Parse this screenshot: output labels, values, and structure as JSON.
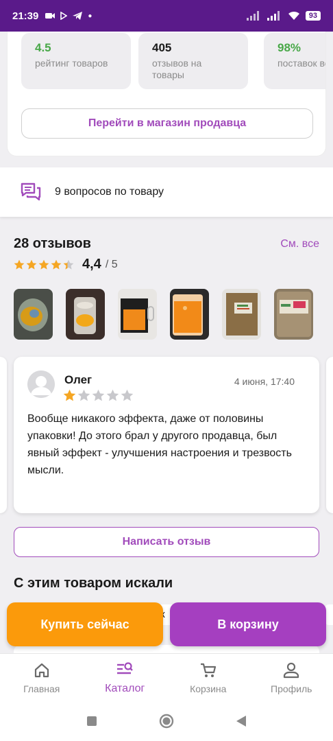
{
  "status_bar": {
    "time": "21:39",
    "battery": "93"
  },
  "seller": {
    "stats": [
      {
        "value": "4.5",
        "label": "рейтинг товаров"
      },
      {
        "value": "405",
        "label": "отзывов на товары"
      },
      {
        "value": "98%",
        "label": "поставок вовремя"
      }
    ],
    "shop_button": "Перейти в магазин продавца"
  },
  "questions": {
    "text": "9 вопросов по товару"
  },
  "reviews": {
    "count_label": "28 отзывов",
    "see_all": "См. все",
    "rating": 4.4,
    "rating_value": "4,4",
    "rating_max": "/ 5",
    "photos": [
      "photo-1",
      "photo-2",
      "photo-3",
      "photo-4",
      "photo-5",
      "photo-6"
    ],
    "items": [
      {
        "author": "Олег",
        "date": "4 июня, 17:40",
        "stars": 1,
        "text": "Вообще никакого эффекта, даже от половины упаковки! До этого брал у другого продавца, был явный эффект - улучшения настроения и трезвость мысли."
      }
    ],
    "write_button": "Написать отзыв"
  },
  "searched": {
    "title": "С этим товаром искали",
    "peek_text": "к"
  },
  "actions": {
    "buy_now": "Купить сейчас",
    "add_to_cart": "В корзину"
  },
  "tabbar": {
    "items": [
      {
        "label": "Главная",
        "icon": "home-icon"
      },
      {
        "label": "Каталог",
        "icon": "catalog-search-icon"
      },
      {
        "label": "Корзина",
        "icon": "cart-icon"
      },
      {
        "label": "Профиль",
        "icon": "profile-icon"
      }
    ],
    "active": "Каталог"
  },
  "colors": {
    "accent": "#a14bbb",
    "buy": "#fb9a0b",
    "cart": "#a53fc0",
    "status_bar": "#5a1a8a",
    "star": "#f5a623"
  }
}
